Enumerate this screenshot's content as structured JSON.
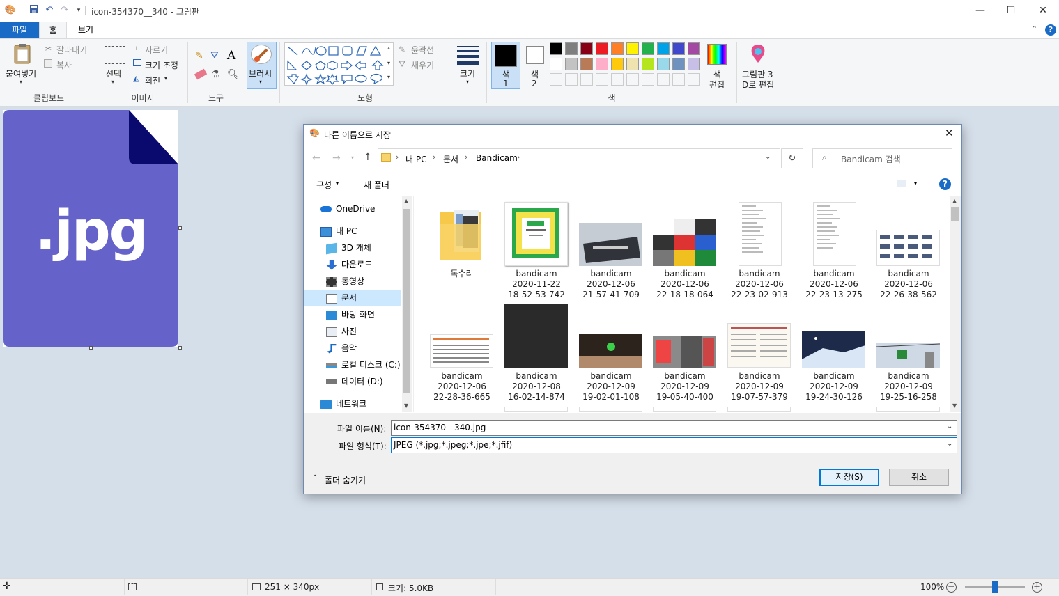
{
  "window": {
    "title": "icon-354370__340 - 그림판",
    "minimize": "—",
    "maximize": "☐",
    "close": "✕"
  },
  "menu_tabs": [
    {
      "label": "파일",
      "active_color": "#1a6bc6"
    },
    {
      "label": "홈"
    },
    {
      "label": "보기"
    }
  ],
  "ribbon": {
    "clipboard": {
      "paste": "붙여넣기",
      "cut": "잘라내기",
      "copy": "복사",
      "group": "클립보드"
    },
    "image": {
      "select": "선택",
      "crop": "자르기",
      "resize": "크기 조정",
      "rotate": "회전",
      "group": "이미지"
    },
    "tools": {
      "group": "도구"
    },
    "brush": {
      "label": "브러시"
    },
    "shapes": {
      "outline": "윤곽선",
      "fill": "채우기",
      "group": "도형"
    },
    "size": {
      "label": "크기"
    },
    "colors": {
      "color1": "색\n1",
      "color1_a": "색",
      "color1_b": "1",
      "color2_a": "색",
      "color2_b": "2",
      "edit_a": "색",
      "edit_b": "편집",
      "group": "색",
      "palette_row1": [
        "#000000",
        "#7f7f7f",
        "#880015",
        "#ed1c24",
        "#ff7f27",
        "#fff200",
        "#22b14c",
        "#00a2e8",
        "#3f48cc",
        "#a349a4"
      ],
      "palette_row2": [
        "#ffffff",
        "#c3c3c3",
        "#b97a57",
        "#ffaec9",
        "#ffc90e",
        "#efe4b0",
        "#b5e61d",
        "#99d9ea",
        "#7092be",
        "#c8bfe7"
      ]
    },
    "paint3d": {
      "line1": "그림판 3",
      "line2": "D로 편집"
    }
  },
  "canvas": {
    "file_label": ".jpg",
    "doc_color": "#6562c9",
    "corner_color": "#0a0a6e"
  },
  "dialog": {
    "title": "다른 이름으로 저장",
    "breadcrumb": [
      "내 PC",
      "문서",
      "Bandicam"
    ],
    "search_placeholder": "Bandicam 검색",
    "organize": "구성",
    "new_folder": "새 폴더",
    "nav_items": [
      {
        "label": "OneDrive",
        "icon": "cloud-icon"
      },
      {
        "label": "내 PC",
        "icon": "computer-icon"
      },
      {
        "label": "3D 개체",
        "icon": "cube-icon"
      },
      {
        "label": "다운로드",
        "icon": "download-icon"
      },
      {
        "label": "동영상",
        "icon": "video-icon"
      },
      {
        "label": "문서",
        "icon": "document-icon"
      },
      {
        "label": "바탕 화면",
        "icon": "desktop-icon"
      },
      {
        "label": "사진",
        "icon": "picture-icon"
      },
      {
        "label": "음악",
        "icon": "music-icon"
      },
      {
        "label": "로컬 디스크 (C:)",
        "icon": "disk-icon"
      },
      {
        "label": "데이터 (D:)",
        "icon": "drive-icon"
      },
      {
        "label": "네트워크",
        "icon": "network-icon"
      }
    ],
    "files_row1": [
      {
        "name": "독수리",
        "l2": "",
        "l3": ""
      },
      {
        "name": "bandicam",
        "l2": "2020-11-22",
        "l3": "18-52-53-742"
      },
      {
        "name": "bandicam",
        "l2": "2020-12-06",
        "l3": "21-57-41-709"
      },
      {
        "name": "bandicam",
        "l2": "2020-12-06",
        "l3": "22-18-18-064"
      },
      {
        "name": "bandicam",
        "l2": "2020-12-06",
        "l3": "22-23-02-913"
      },
      {
        "name": "bandicam",
        "l2": "2020-12-06",
        "l3": "22-23-13-275"
      },
      {
        "name": "bandicam",
        "l2": "2020-12-06",
        "l3": "22-26-38-562"
      }
    ],
    "files_row2": [
      {
        "name": "bandicam",
        "l2": "2020-12-06",
        "l3": "22-28-36-665"
      },
      {
        "name": "bandicam",
        "l2": "2020-12-08",
        "l3": "16-02-14-874"
      },
      {
        "name": "bandicam",
        "l2": "2020-12-09",
        "l3": "19-02-01-108"
      },
      {
        "name": "bandicam",
        "l2": "2020-12-09",
        "l3": "19-05-40-400"
      },
      {
        "name": "bandicam",
        "l2": "2020-12-09",
        "l3": "19-07-57-379"
      },
      {
        "name": "bandicam",
        "l2": "2020-12-09",
        "l3": "19-24-30-126"
      },
      {
        "name": "bandicam",
        "l2": "2020-12-09",
        "l3": "19-25-16-258"
      }
    ],
    "filename_label": "파일 이름(N):",
    "filename_value": "icon-354370__340.jpg",
    "filetype_label": "파일 형식(T):",
    "filetype_value": "JPEG (*.jpg;*.jpeg;*.jpe;*.jfif)",
    "hide_folders": "폴더 숨기기",
    "save": "저장(S)",
    "cancel": "취소"
  },
  "status": {
    "dimensions": "251 × 340px",
    "size": "크기: 5.0KB",
    "zoom": "100%"
  }
}
